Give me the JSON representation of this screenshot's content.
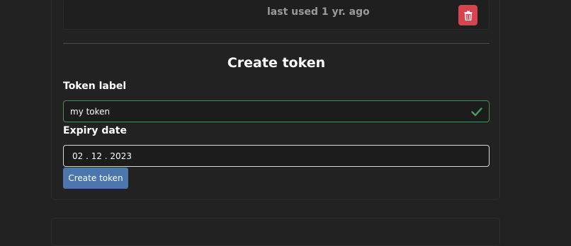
{
  "token_list": {
    "rows": [
      {
        "name": "",
        "last_used": "last used 1 yr. ago"
      }
    ]
  },
  "create_section": {
    "title": "Create token",
    "token_label": {
      "label": "Token label",
      "value": "my token"
    },
    "expiry_date": {
      "label": "Expiry date",
      "value": "02 . 12 . 2023"
    },
    "submit_label": "Create token"
  },
  "colors": {
    "page_bg": "#212121",
    "card_bg": "#222222",
    "danger": "#d9434f",
    "primary": "#4a75ad",
    "valid": "#4f8a5a"
  },
  "icons": {
    "delete": "trash-icon",
    "valid": "check-icon"
  }
}
